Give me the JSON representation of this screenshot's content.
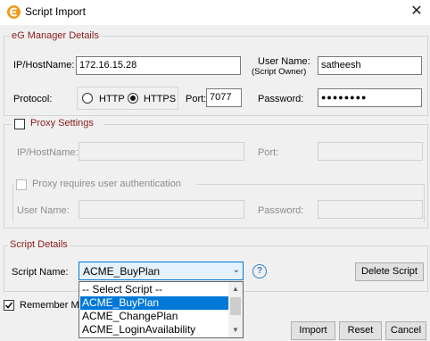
{
  "window": {
    "title": "Script Import",
    "close_glyph": "✕"
  },
  "manager": {
    "legend": "eG Manager Details",
    "ip_label": "IP/HostName:",
    "ip_value": "172.16.15.28",
    "user_label_line1": "User Name:",
    "user_label_line2": "(Script Owner)",
    "user_value": "satheesh",
    "protocol_label": "Protocol:",
    "http_label": "HTTP",
    "https_label": "HTTPS",
    "protocol_selected": "HTTPS",
    "port_label": "Port:",
    "port_value": "7077",
    "password_label": "Password:",
    "password_value": "●●●●●●●●"
  },
  "proxy": {
    "legend": "Proxy Settings",
    "enabled": false,
    "ip_label": "IP/HostName:",
    "port_label": "Port:",
    "auth_label": "Proxy requires user authentication",
    "user_label": "User Name:",
    "password_label": "Password:"
  },
  "script": {
    "legend": "Script Details",
    "name_label": "Script Name:",
    "selected": "ACME_BuyPlan",
    "options": [
      "-- Select Script --",
      "ACME_BuyPlan",
      "ACME_ChangePlan",
      "ACME_LoginAvailability"
    ],
    "highlighted_index": 1,
    "help_glyph": "?",
    "delete_label": "Delete Script"
  },
  "remember": {
    "label": "Remember Me",
    "checked": true
  },
  "buttons": {
    "import": "Import",
    "reset": "Reset",
    "cancel": "Cancel"
  },
  "colors": {
    "legend": "#8b1a1a",
    "accent": "#0078d7",
    "help": "#2f7fd0",
    "app_icon": "#f09a1b"
  }
}
